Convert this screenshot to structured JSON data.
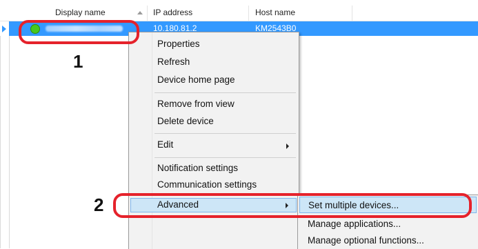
{
  "listview": {
    "columns": [
      "Display name",
      "IP address",
      "Host name"
    ],
    "selected_row": {
      "ip_address": "10.180.81.2",
      "host_name": "KM2543B0"
    }
  },
  "callouts": {
    "step1": "1",
    "step2": "2"
  },
  "context_menu": {
    "items": {
      "properties": "Properties",
      "refresh": "Refresh",
      "device_home_page": "Device home page",
      "remove_from_view": "Remove from view",
      "delete_device": "Delete device",
      "edit": "Edit",
      "notification_settings": "Notification settings",
      "communication_settings": "Communication settings",
      "advanced": "Advanced"
    }
  },
  "advanced_submenu": {
    "items": {
      "set_multiple_devices": "Set multiple devices...",
      "manage_applications": "Manage applications...",
      "manage_optional_functions": "Manage optional functions..."
    }
  },
  "colors": {
    "selection": "#3399ff",
    "callout_red": "#e5222b",
    "status_green": "#46c81e",
    "menu_highlight": "#cde6f7"
  },
  "icons": [
    "row-pointer-icon",
    "status-online-icon",
    "sort-ascending-icon",
    "submenu-arrow-icon"
  ]
}
